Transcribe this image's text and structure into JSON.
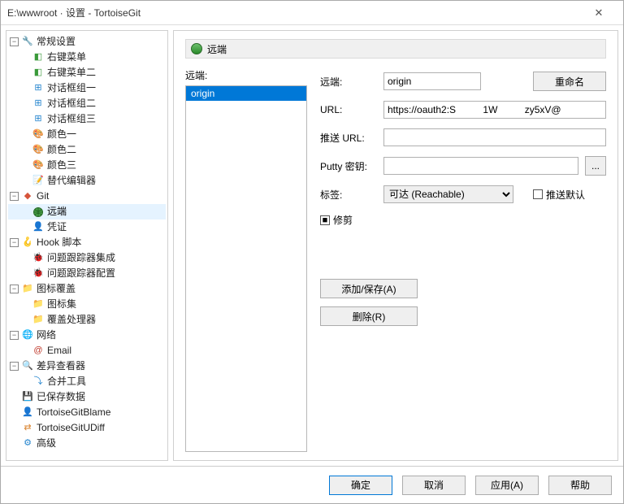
{
  "window": {
    "title": "E:\\wwwroot          · 设置 - TortoiseGit",
    "close": "✕"
  },
  "tree": {
    "general": {
      "label": "常规设置"
    },
    "context_menu": {
      "label": "右键菜单"
    },
    "context_menu2": {
      "label": "右键菜单二"
    },
    "dlg1": {
      "label": "对话框组一"
    },
    "dlg2": {
      "label": "对话框组二"
    },
    "dlg3": {
      "label": "对话框组三"
    },
    "color1": {
      "label": "颜色一"
    },
    "color2": {
      "label": "颜色二"
    },
    "color3": {
      "label": "颜色三"
    },
    "alt_editor": {
      "label": "替代编辑器"
    },
    "git": {
      "label": "Git"
    },
    "remote": {
      "label": "远端"
    },
    "credential": {
      "label": "凭证"
    },
    "hook": {
      "label": "Hook 脚本"
    },
    "issue_integ": {
      "label": "问题跟踪器集成"
    },
    "issue_cfg": {
      "label": "问题跟踪器配置"
    },
    "overlay": {
      "label": "图标覆盖"
    },
    "iconset": {
      "label": "图标集"
    },
    "ovlhandler": {
      "label": "覆盖处理器"
    },
    "network": {
      "label": "网络"
    },
    "email": {
      "label": "Email"
    },
    "diffviewer": {
      "label": "差异查看器"
    },
    "mergetool": {
      "label": "合并工具"
    },
    "saveddata": {
      "label": "已保存数据"
    },
    "tgitblame": {
      "label": "TortoiseGitBlame"
    },
    "tgitudiff": {
      "label": "TortoiseGitUDiff"
    },
    "advanced": {
      "label": "高级"
    }
  },
  "panel": {
    "header": "远端",
    "list_label": "远端:",
    "list_items": [
      "origin"
    ],
    "form": {
      "remote_label": "远端:",
      "remote_value": "origin",
      "rename_btn": "重命名",
      "url_label": "URL:",
      "url_value": "https://oauth2:S          1W          zy5xV@",
      "pushurl_label": "推送 URL:",
      "pushurl_value": "",
      "putty_label": "Putty 密钥:",
      "putty_value": "",
      "browse_btn": "...",
      "tags_label": "标签:",
      "tags_value": "可达 (Reachable)",
      "pushdefault_label": "推送默认",
      "prune_label": "修剪",
      "add_save_btn": "添加/保存(A)",
      "delete_btn": "删除(R)"
    }
  },
  "buttons": {
    "ok": "确定",
    "cancel": "取消",
    "apply": "应用(A)",
    "help": "帮助"
  }
}
